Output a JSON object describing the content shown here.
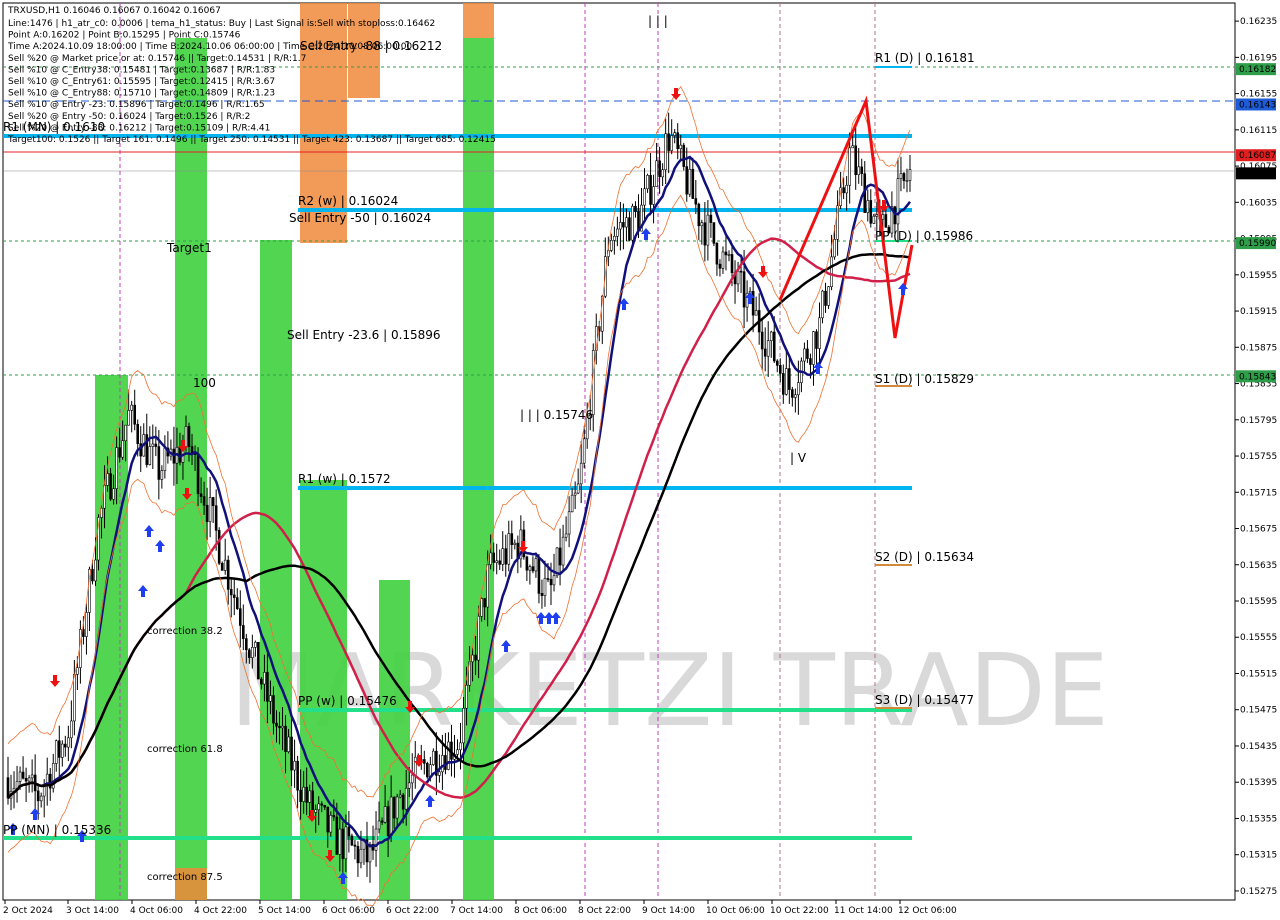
{
  "chart_data": {
    "type": "line",
    "symbol": "TRXUSD",
    "timeframe": "H1",
    "header": "TRXUSD,H1  0.16046 0.16067 0.16042 0.16067",
    "info_lines": [
      "Line:1476 | h1_atr_c0: 0.0006 | tema_h1_status: Buy | Last Signal is:Sell with stoploss:0.16462",
      "Point A:0.16202 | Point B:0.15295 | Point C:0.15746",
      "Time A:2024.10.09 18:00:00 | Time B:2024.10.06 06:00:00 | Time C:2024.10.08 06:00:00",
      "Sell %20 @ Market price or at: 0.15746 || Target:0.14531 | R/R:1.7",
      "Sell %10 @ C_Entry38: 0.15481 | Target:0.13687 | R/R:1.83",
      "Sell %10 @ C_Entry61: 0.15595 | Target:0.12415 | R/R:3.67",
      "Sell %10 @ C_Entry88: 0.15710 | Target:0.14809 | R/R:1.23",
      "Sell %10 @ Entry -23: 0.15896 | Target:0.1496 | R/R:1.65",
      "Sell %20 @ Entry -50: 0.16024 | Target:0.1526 | R/R:2",
      "Sell %20 @ Entry -88: 0.16212 | Target:0.15109 | R/R:4.41",
      "Target100: 0.1526 || Target 161: 0.1496 || Target 250: 0.14531 || Target 423: 0.13687 || Target 685: 0.12415"
    ],
    "y_ticks": [
      "0.16235",
      "0.16195",
      "0.16155",
      "0.16115",
      "0.16075",
      "0.16035",
      "0.15995",
      "0.15955",
      "0.15915",
      "0.15875",
      "0.15835",
      "0.15795",
      "0.15755",
      "0.15715",
      "0.15675",
      "0.15635",
      "0.15595",
      "0.15555",
      "0.15515",
      "0.15475",
      "0.15435",
      "0.15395",
      "0.15355",
      "0.15315",
      "0.15275"
    ],
    "x_ticks": [
      "2 Oct 2024",
      "3 Oct 14:00",
      "4 Oct 06:00",
      "4 Oct 22:00",
      "5 Oct 14:00",
      "6 Oct 06:00",
      "6 Oct 22:00",
      "7 Oct 14:00",
      "8 Oct 06:00",
      "8 Oct 22:00",
      "9 Oct 14:00",
      "10 Oct 06:00",
      "10 Oct 22:00",
      "11 Oct 14:00",
      "12 Oct 06:00"
    ],
    "price_badges": [
      {
        "value": "0.16182",
        "color": "#2e9e4a"
      },
      {
        "value": "0.16143",
        "color": "#1e5bd6"
      },
      {
        "value": "0.16087",
        "color": "#e02020"
      },
      {
        "value": "0.16067",
        "color": "#000000"
      },
      {
        "value": "0.15990",
        "color": "#2e9e4a"
      },
      {
        "value": "0.15843",
        "color": "#2e9e4a"
      }
    ],
    "levels": [
      {
        "label": "R1 (D) | 0.16181",
        "value": 0.16181
      },
      {
        "label": "R2 (w) | 0.16024",
        "value": 0.16024
      },
      {
        "label": "Sell Entry -50 | 0.16024",
        "value": 0.16024
      },
      {
        "label": "PP (D) | 0.15986",
        "value": 0.15986
      },
      {
        "label": "Sell Entry -23.6 | 0.15896",
        "value": 0.15896
      },
      {
        "label": "S1 (D) | 0.15829",
        "value": 0.15829
      },
      {
        "label": "R1 (w) | 0.1572",
        "value": 0.1572
      },
      {
        "label": "S2 (D) | 0.15634",
        "value": 0.15634
      },
      {
        "label": "PP (w) | 0.15476",
        "value": 0.15476
      },
      {
        "label": "S3 (D) | 0.15477",
        "value": 0.15477
      },
      {
        "label": "PP (MN) | 0.15336",
        "value": 0.15336
      },
      {
        "label": "R1 (MN) | 0.1610",
        "value": 0.161
      }
    ],
    "annotations": [
      {
        "text": "Target1"
      },
      {
        "text": "100"
      },
      {
        "text": "correction 38.2"
      },
      {
        "text": "correction 61.8"
      },
      {
        "text": "correction 87.5"
      },
      {
        "text": "| | | 0.15746"
      },
      {
        "text": "| | |"
      },
      {
        "text": "| V"
      },
      {
        "text": "Sell Entry -88 | 0.16212"
      }
    ],
    "watermark": "MARKETZI TRADE",
    "price_path": [
      [
        "2 Oct 2024",
        0.154
      ],
      [
        "3 Oct 02:00",
        0.1538
      ],
      [
        "3 Oct 14:00",
        0.1545
      ],
      [
        "3 Oct 20:00",
        0.1568
      ],
      [
        "4 Oct 02:00",
        0.158
      ],
      [
        "4 Oct 06:00",
        0.1574
      ],
      [
        "4 Oct 12:00",
        0.1577
      ],
      [
        "4 Oct 18:00",
        0.1566
      ],
      [
        "4 Oct 22:00",
        0.1555
      ],
      [
        "5 Oct 06:00",
        0.1545
      ],
      [
        "5 Oct 14:00",
        0.1537
      ],
      [
        "5 Oct 22:00",
        0.1533
      ],
      [
        "6 Oct 06:00",
        0.1531
      ],
      [
        "6 Oct 14:00",
        0.1538
      ],
      [
        "6 Oct 22:00",
        0.1542
      ],
      [
        "7 Oct 06:00",
        0.1544
      ],
      [
        "7 Oct 14:00",
        0.1563
      ],
      [
        "7 Oct 22:00",
        0.1566
      ],
      [
        "8 Oct 06:00",
        0.156
      ],
      [
        "8 Oct 14:00",
        0.1572
      ],
      [
        "8 Oct 22:00",
        0.16
      ],
      [
        "9 Oct 06:00",
        0.1602
      ],
      [
        "9 Oct 14:00",
        0.1611
      ],
      [
        "9 Oct 22:00",
        0.1602
      ],
      [
        "10 Oct 06:00",
        0.1596
      ],
      [
        "10 Oct 14:00",
        0.159
      ],
      [
        "10 Oct 22:00",
        0.1583
      ],
      [
        "11 Oct 06:00",
        0.159
      ],
      [
        "11 Oct 14:00",
        0.1609
      ],
      [
        "11 Oct 22:00",
        0.16
      ],
      [
        "12 Oct 06:00",
        0.16067
      ]
    ]
  }
}
